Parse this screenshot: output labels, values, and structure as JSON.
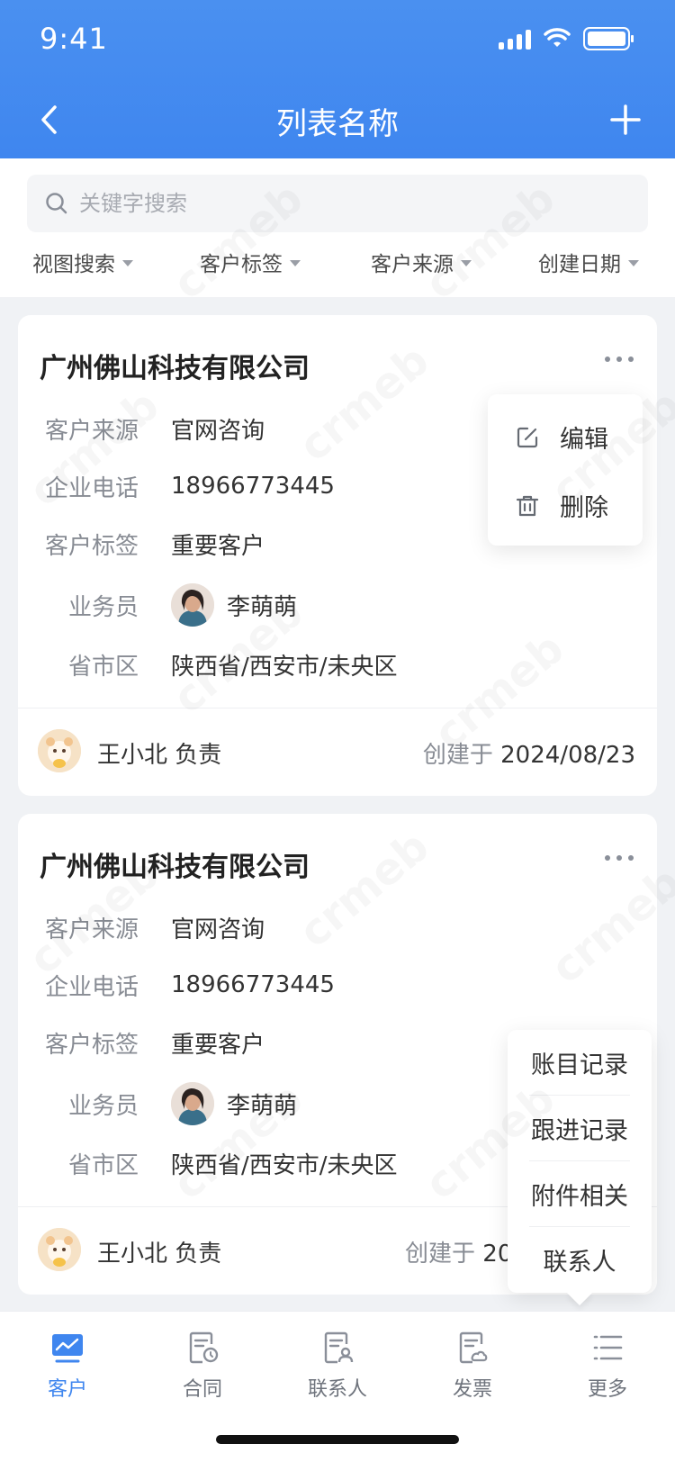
{
  "status_bar": {
    "time": "9:41"
  },
  "nav": {
    "title": "列表名称"
  },
  "search": {
    "placeholder": "关键字搜索"
  },
  "filters": [
    "视图搜索",
    "客户标签",
    "客户来源",
    "创建日期"
  ],
  "labels": {
    "source": "客户来源",
    "phone": "企业电话",
    "tag": "客户标签",
    "salesperson": "业务员",
    "region": "省市区",
    "created_prefix": "创建于"
  },
  "cards": [
    {
      "company": "广州佛山科技有限公司",
      "source": "官网咨询",
      "phone": "18966773445",
      "tag": "重要客户",
      "salesperson": "李萌萌",
      "region": "陕西省/西安市/未央区",
      "owner": "王小北 负责",
      "created": "2024/08/23"
    },
    {
      "company": "广州佛山科技有限公司",
      "source": "官网咨询",
      "phone": "18966773445",
      "tag": "重要客户",
      "salesperson": "李萌萌",
      "region": "陕西省/西安市/未央区",
      "owner": "王小北 负责",
      "created": "20"
    }
  ],
  "popover_actions": {
    "edit": "编辑",
    "delete": "删除"
  },
  "more_menu": [
    "账目记录",
    "跟进记录",
    "附件相关",
    "联系人"
  ],
  "tabs": [
    {
      "label": "客户",
      "icon": "monitor-chart-icon",
      "active": true
    },
    {
      "label": "合同",
      "icon": "contract-icon",
      "active": false
    },
    {
      "label": "联系人",
      "icon": "contact-doc-icon",
      "active": false
    },
    {
      "label": "发票",
      "icon": "invoice-icon",
      "active": false
    },
    {
      "label": "更多",
      "icon": "list-icon",
      "active": false
    }
  ],
  "watermark_text": "crmeb",
  "colors": {
    "primary": "#3f86ef",
    "background": "#f0f2f5"
  }
}
